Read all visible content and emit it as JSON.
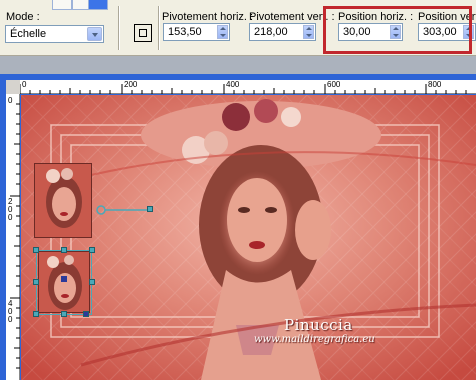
{
  "toolbar": {
    "mode_label": "Mode :",
    "mode_value": "Échelle",
    "pivot_h_label": "Pivotement horiz. :",
    "pivot_h_value": "153,50",
    "pivot_v_label": "Pivotement vert. :",
    "pivot_v_value": "218,00",
    "pos_h_label": "Position horiz. :",
    "pos_h_value": "30,00",
    "pos_v_label": "Position vert. :",
    "pos_v_value": "303,00"
  },
  "ruler": {
    "top_ticks": [
      "0",
      "200",
      "400",
      "600",
      "800"
    ],
    "left_ticks": [
      "0",
      "200",
      "400"
    ]
  },
  "watermark": {
    "name": "Pinuccia",
    "url": "www.maildiregrafica.eu"
  },
  "colors": {
    "accent_red": "#C1272D",
    "canvas_base": "#D36155",
    "window_blue": "#2E64D6"
  }
}
